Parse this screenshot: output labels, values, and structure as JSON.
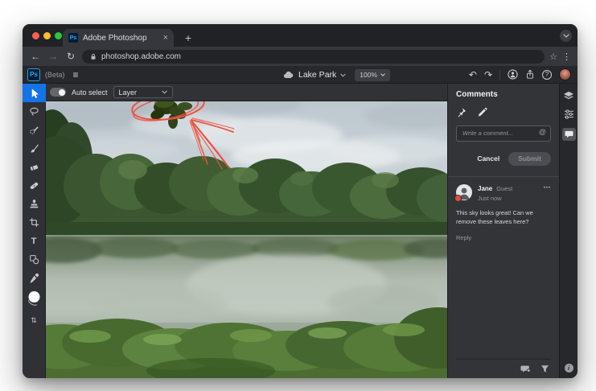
{
  "browser": {
    "traffic_lights": {
      "close": "#ff5f57",
      "minimize": "#febc2e",
      "maximize": "#28c840"
    },
    "tab": {
      "title": "Adobe Photoshop",
      "favicon_text": "Ps",
      "close_glyph": "×"
    },
    "new_tab_glyph": "+",
    "nav": {
      "back_glyph": "←",
      "forward_glyph": "→",
      "reload_glyph": "↻"
    },
    "url": "photoshop.adobe.com",
    "bookmark_glyph": "☆",
    "menu_glyph": "⋮"
  },
  "app_bar": {
    "logo_text": "Ps",
    "beta_label": "(Beta)",
    "menu_glyph": "≡",
    "doc_name": "Lake Park",
    "zoom_value": "100%",
    "undo_glyph": "↶",
    "redo_glyph": "↷",
    "help_glyph": "?"
  },
  "options_bar": {
    "auto_select_label": "Auto select",
    "layer_value": "Layer"
  },
  "toolbar": {
    "selected_tool": "move",
    "type_glyph": "T",
    "swap_glyph": "⇅",
    "tools": [
      "move",
      "lasso",
      "quick-select",
      "brush",
      "eraser",
      "healing-brush",
      "clone-stamp",
      "crop",
      "type",
      "shapes",
      "eyedropper",
      "color-swatch",
      "swap-colors"
    ]
  },
  "comments_panel": {
    "title": "Comments",
    "composer": {
      "placeholder": "Write a comment...",
      "mention_glyph": "@",
      "cancel_label": "Cancel",
      "submit_label": "Submit"
    },
    "comment": {
      "author": "Jane",
      "role": "Guest",
      "time": "Just now",
      "body": "This sky looks great! Can we remove these leaves here?",
      "reply_label": "Reply",
      "more_glyph": "•••"
    }
  },
  "rail": {
    "info_glyph": "i"
  },
  "colors": {
    "accent_blue": "#1473e6",
    "logo_blue": "#31a8ff",
    "annotation_red": "#ee5140",
    "badge_red": "#e5493a"
  }
}
